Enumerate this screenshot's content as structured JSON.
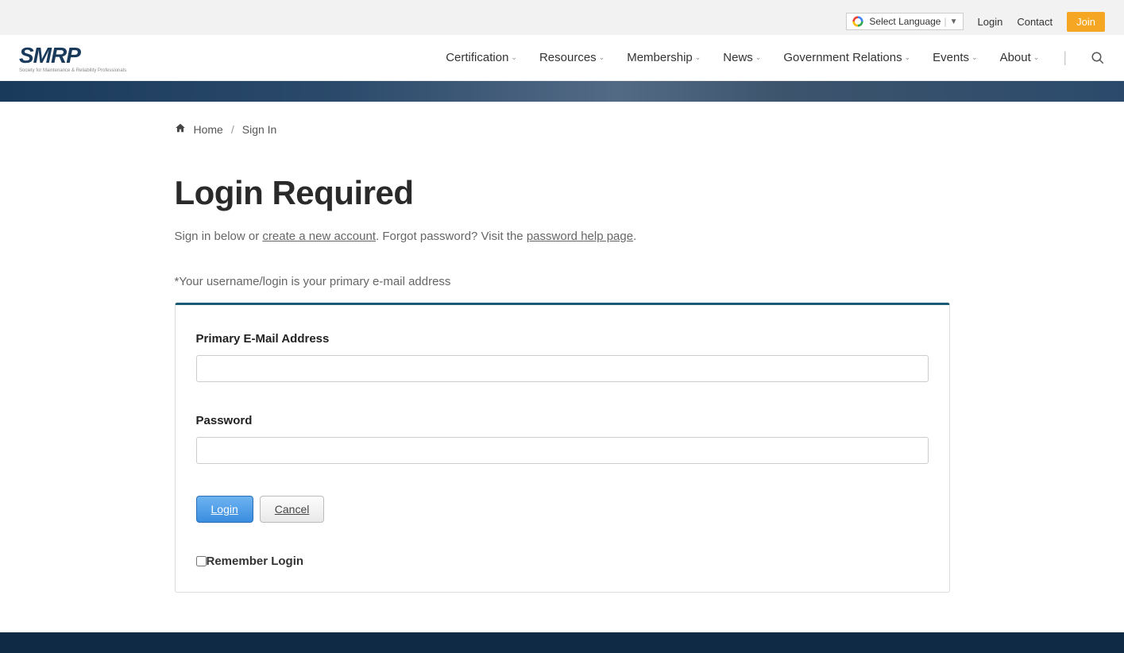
{
  "utility": {
    "language": "Select Language",
    "login": "Login",
    "contact": "Contact",
    "join": "Join"
  },
  "logo": {
    "main": "SMRP",
    "sub": "Society for Maintenance & Reliability Professionals"
  },
  "nav": [
    {
      "label": "Certification"
    },
    {
      "label": "Resources"
    },
    {
      "label": "Membership"
    },
    {
      "label": "News"
    },
    {
      "label": "Government Relations"
    },
    {
      "label": "Events"
    },
    {
      "label": "About"
    }
  ],
  "breadcrumb": {
    "home": "Home",
    "current": "Sign In"
  },
  "page": {
    "title": "Login Required",
    "instruction_prefix": "Sign in below or ",
    "create_account": "create a new account",
    "instruction_mid": ". Forgot password? Visit the ",
    "password_help": "password help page",
    "instruction_suffix": ".",
    "note": "*Your username/login is your primary e-mail address"
  },
  "form": {
    "email_label": "Primary E-Mail Address",
    "password_label": "Password",
    "login_button": "Login",
    "cancel_button": "Cancel",
    "remember": "Remember Login"
  }
}
